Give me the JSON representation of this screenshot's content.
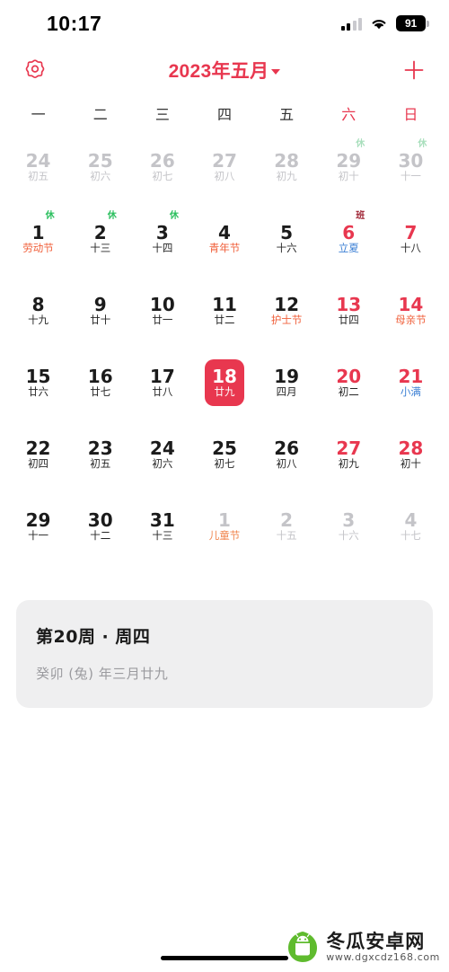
{
  "status_bar": {
    "time": "10:17",
    "battery_level": "91",
    "signal_icon": "signal-bars-icon",
    "wifi_icon": "wifi-icon",
    "battery_icon": "battery-icon"
  },
  "nav": {
    "settings_icon": "gear-icon",
    "title": "2023年五月",
    "caret_icon": "chevron-down-icon",
    "add_icon": "plus-icon"
  },
  "weekdays": [
    {
      "label": "一",
      "weekend": false
    },
    {
      "label": "二",
      "weekend": false
    },
    {
      "label": "三",
      "weekend": false
    },
    {
      "label": "四",
      "weekend": false
    },
    {
      "label": "五",
      "weekend": false
    },
    {
      "label": "六",
      "weekend": true
    },
    {
      "label": "日",
      "weekend": true
    }
  ],
  "colors": {
    "accent_red": "#E8374F",
    "festival_orange": "#F0613C",
    "solar_term_blue": "#3B7FD4",
    "rest_green": "#2BBF5E",
    "work_maroon": "#9E2232",
    "dim_gray": "#C4C4C8",
    "card_bg": "#EFEFF0"
  },
  "days": [
    {
      "num": "24",
      "lunar": "初五",
      "style": "dim",
      "lunar_style": "dim",
      "badge": "",
      "selected": false
    },
    {
      "num": "25",
      "lunar": "初六",
      "style": "dim",
      "lunar_style": "dim",
      "badge": "",
      "selected": false
    },
    {
      "num": "26",
      "lunar": "初七",
      "style": "dim",
      "lunar_style": "dim",
      "badge": "",
      "selected": false
    },
    {
      "num": "27",
      "lunar": "初八",
      "style": "dim",
      "lunar_style": "dim",
      "badge": "",
      "selected": false
    },
    {
      "num": "28",
      "lunar": "初九",
      "style": "dim",
      "lunar_style": "dim",
      "badge": "",
      "selected": false
    },
    {
      "num": "29",
      "lunar": "初十",
      "style": "dim",
      "lunar_style": "dim",
      "badge": "休-dim",
      "selected": false
    },
    {
      "num": "30",
      "lunar": "十一",
      "style": "dim",
      "lunar_style": "dim",
      "badge": "休-dim",
      "selected": false
    },
    {
      "num": "1",
      "lunar": "劳动节",
      "style": "normal",
      "lunar_style": "fest",
      "badge": "休",
      "selected": false
    },
    {
      "num": "2",
      "lunar": "十三",
      "style": "normal",
      "lunar_style": "normal",
      "badge": "休",
      "selected": false
    },
    {
      "num": "3",
      "lunar": "十四",
      "style": "normal",
      "lunar_style": "normal",
      "badge": "休",
      "selected": false
    },
    {
      "num": "4",
      "lunar": "青年节",
      "style": "normal",
      "lunar_style": "fest",
      "badge": "",
      "selected": false
    },
    {
      "num": "5",
      "lunar": "十六",
      "style": "normal",
      "lunar_style": "normal",
      "badge": "",
      "selected": false
    },
    {
      "num": "6",
      "lunar": "立夏",
      "style": "red",
      "lunar_style": "term",
      "badge": "班",
      "selected": false
    },
    {
      "num": "7",
      "lunar": "十八",
      "style": "red",
      "lunar_style": "normal",
      "badge": "",
      "selected": false
    },
    {
      "num": "8",
      "lunar": "十九",
      "style": "normal",
      "lunar_style": "normal",
      "badge": "",
      "selected": false
    },
    {
      "num": "9",
      "lunar": "廿十",
      "style": "normal",
      "lunar_style": "normal",
      "badge": "",
      "selected": false
    },
    {
      "num": "10",
      "lunar": "廿一",
      "style": "normal",
      "lunar_style": "normal",
      "badge": "",
      "selected": false
    },
    {
      "num": "11",
      "lunar": "廿二",
      "style": "normal",
      "lunar_style": "normal",
      "badge": "",
      "selected": false
    },
    {
      "num": "12",
      "lunar": "护士节",
      "style": "normal",
      "lunar_style": "fest",
      "badge": "",
      "selected": false
    },
    {
      "num": "13",
      "lunar": "廿四",
      "style": "red",
      "lunar_style": "normal",
      "badge": "",
      "selected": false
    },
    {
      "num": "14",
      "lunar": "母亲节",
      "style": "red",
      "lunar_style": "fest",
      "badge": "",
      "selected": false
    },
    {
      "num": "15",
      "lunar": "廿六",
      "style": "normal",
      "lunar_style": "normal",
      "badge": "",
      "selected": false
    },
    {
      "num": "16",
      "lunar": "廿七",
      "style": "normal",
      "lunar_style": "normal",
      "badge": "",
      "selected": false
    },
    {
      "num": "17",
      "lunar": "廿八",
      "style": "normal",
      "lunar_style": "normal",
      "badge": "",
      "selected": false
    },
    {
      "num": "18",
      "lunar": "廿九",
      "style": "normal",
      "lunar_style": "normal",
      "badge": "",
      "selected": true
    },
    {
      "num": "19",
      "lunar": "四月",
      "style": "normal",
      "lunar_style": "normal",
      "badge": "",
      "selected": false
    },
    {
      "num": "20",
      "lunar": "初二",
      "style": "red",
      "lunar_style": "normal",
      "badge": "",
      "selected": false
    },
    {
      "num": "21",
      "lunar": "小满",
      "style": "red",
      "lunar_style": "term",
      "badge": "",
      "selected": false
    },
    {
      "num": "22",
      "lunar": "初四",
      "style": "normal",
      "lunar_style": "normal",
      "badge": "",
      "selected": false
    },
    {
      "num": "23",
      "lunar": "初五",
      "style": "normal",
      "lunar_style": "normal",
      "badge": "",
      "selected": false
    },
    {
      "num": "24",
      "lunar": "初六",
      "style": "normal",
      "lunar_style": "normal",
      "badge": "",
      "selected": false
    },
    {
      "num": "25",
      "lunar": "初七",
      "style": "normal",
      "lunar_style": "normal",
      "badge": "",
      "selected": false
    },
    {
      "num": "26",
      "lunar": "初八",
      "style": "normal",
      "lunar_style": "normal",
      "badge": "",
      "selected": false
    },
    {
      "num": "27",
      "lunar": "初九",
      "style": "red",
      "lunar_style": "normal",
      "badge": "",
      "selected": false
    },
    {
      "num": "28",
      "lunar": "初十",
      "style": "red",
      "lunar_style": "normal",
      "badge": "",
      "selected": false
    },
    {
      "num": "29",
      "lunar": "十一",
      "style": "normal",
      "lunar_style": "normal",
      "badge": "",
      "selected": false
    },
    {
      "num": "30",
      "lunar": "十二",
      "style": "normal",
      "lunar_style": "normal",
      "badge": "",
      "selected": false
    },
    {
      "num": "31",
      "lunar": "十三",
      "style": "normal",
      "lunar_style": "normal",
      "badge": "",
      "selected": false
    },
    {
      "num": "1",
      "lunar": "儿童节",
      "style": "dim",
      "lunar_style": "dimfest",
      "badge": "",
      "selected": false
    },
    {
      "num": "2",
      "lunar": "十五",
      "style": "dim",
      "lunar_style": "dim",
      "badge": "",
      "selected": false
    },
    {
      "num": "3",
      "lunar": "十六",
      "style": "dim",
      "lunar_style": "dim",
      "badge": "",
      "selected": false
    },
    {
      "num": "4",
      "lunar": "十七",
      "style": "dim",
      "lunar_style": "dim",
      "badge": "",
      "selected": false
    }
  ],
  "info_card": {
    "title": "第20周 · 周四",
    "subtitle": "癸卯 (兔) 年三月廿九"
  },
  "watermark": {
    "name": "冬瓜安卓网",
    "url": "www.dgxcdz168.com",
    "logo_icon": "android-mascot-icon"
  }
}
